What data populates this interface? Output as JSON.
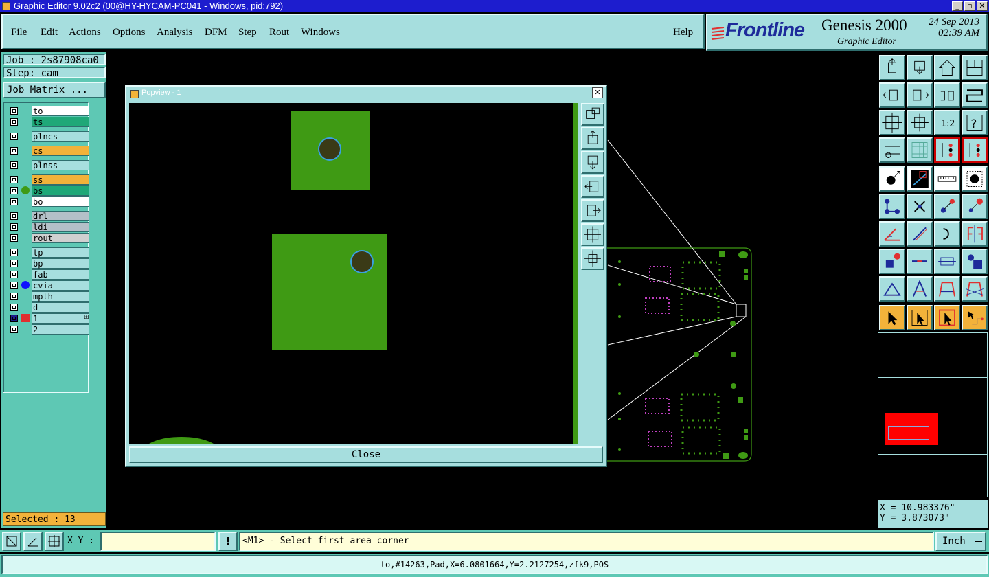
{
  "window": {
    "title": "Graphic Editor 9.02c2 (00@HY-HYCAM-PC041 - Windows, pid:792)",
    "min_label": "_",
    "max_label": "▫",
    "close_label": "✕"
  },
  "menu": [
    "File",
    "Edit",
    "Actions",
    "Options",
    "Analysis",
    "DFM",
    "Step",
    "Rout",
    "Windows"
  ],
  "help_label": "Help",
  "brand": {
    "logo": "Frontline",
    "product": "Genesis 2000",
    "subtitle": "Graphic Editor",
    "date": "24 Sep 2013",
    "time": "02:39 AM"
  },
  "job": {
    "job_label": "Job : 2s87908ca0",
    "step_label": "Step: cam",
    "matrix_button": "Job Matrix ..."
  },
  "layers": [
    {
      "name": "to",
      "color": "#ffffff"
    },
    {
      "name": "ts",
      "color": "#1fa878"
    },
    {
      "name": "plncs",
      "color": "#a6dede"
    },
    {
      "name": "cs",
      "color": "#f2b23a"
    },
    {
      "name": "plnss",
      "color": "#a6dede"
    },
    {
      "name": "ss",
      "color": "#f2b23a"
    },
    {
      "name": "bs",
      "color": "#1fa878",
      "marker": "#3f9a14"
    },
    {
      "name": "bo",
      "color": "#ffffff"
    },
    {
      "name": "drl",
      "color": "#b4c0c8"
    },
    {
      "name": "ldi",
      "color": "#b4c0c8"
    },
    {
      "name": "rout",
      "color": "#d0d0d0"
    },
    {
      "name": "tp",
      "color": "#a6dede"
    },
    {
      "name": "bp",
      "color": "#a6dede"
    },
    {
      "name": "fab",
      "color": "#a6dede"
    },
    {
      "name": "cvia",
      "color": "#a6dede",
      "marker": "#1010ff"
    },
    {
      "name": "mpth",
      "color": "#a6dede"
    },
    {
      "name": "d",
      "color": "#a6dede"
    },
    {
      "name": "1",
      "color": "#a6dede",
      "work": true,
      "suffix": "⊞"
    },
    {
      "name": "2",
      "color": "#a6dede"
    }
  ],
  "selected_label": "Selected : 13",
  "popview": {
    "title": "Popview - 1",
    "close_label": "Close",
    "close_x": "✕"
  },
  "coords": {
    "x": "X = 10.983376\"",
    "y": "Y = 3.873073\""
  },
  "command": {
    "xy_label": "X Y :",
    "xy_value": "",
    "prompt": "<M1> - Select first area corner",
    "units": "Inch"
  },
  "status_text": "to,#14263,Pad,X=6.0801664,Y=2.2127254,zfk9,POS",
  "colors": {
    "panel": "#a6dede",
    "panel_dark": "#5ec8b4",
    "pad_green": "#3f9a14",
    "drill": "#3a3a16",
    "drill_ring": "#3aa0e0",
    "silk": "#c040c0"
  },
  "toolbar_icons": [
    "zoom-home-icon",
    "zoom-previous-icon",
    "home-icon",
    "split-view-icon",
    "pan-left-icon",
    "pan-right-icon",
    "undo-view-icon",
    "redraw-icon",
    "fit-screen-icon",
    "fit-profile-icon",
    "zoom-1-2-icon",
    "query-icon",
    "graphic-settings-icon",
    "grid-icon",
    "snap-center-icon",
    "snap-edge-icon",
    "add-pad-icon",
    "add-line-icon",
    "measure-icon",
    "add-circle-icon",
    "move-icon",
    "delete-icon",
    "copy-icon",
    "resize-icon",
    "angle-icon",
    "draw-line-icon",
    "rotate-icon",
    "mirror-icon",
    "pad-attrs-icon",
    "cut-line-icon",
    "stretch-icon",
    "group-icon",
    "fillet-icon",
    "arc-icon",
    "polygon-icon",
    "polygon-cross-icon",
    "select-icon",
    "select-box-icon",
    "select-orange-icon",
    "route-select-icon"
  ]
}
